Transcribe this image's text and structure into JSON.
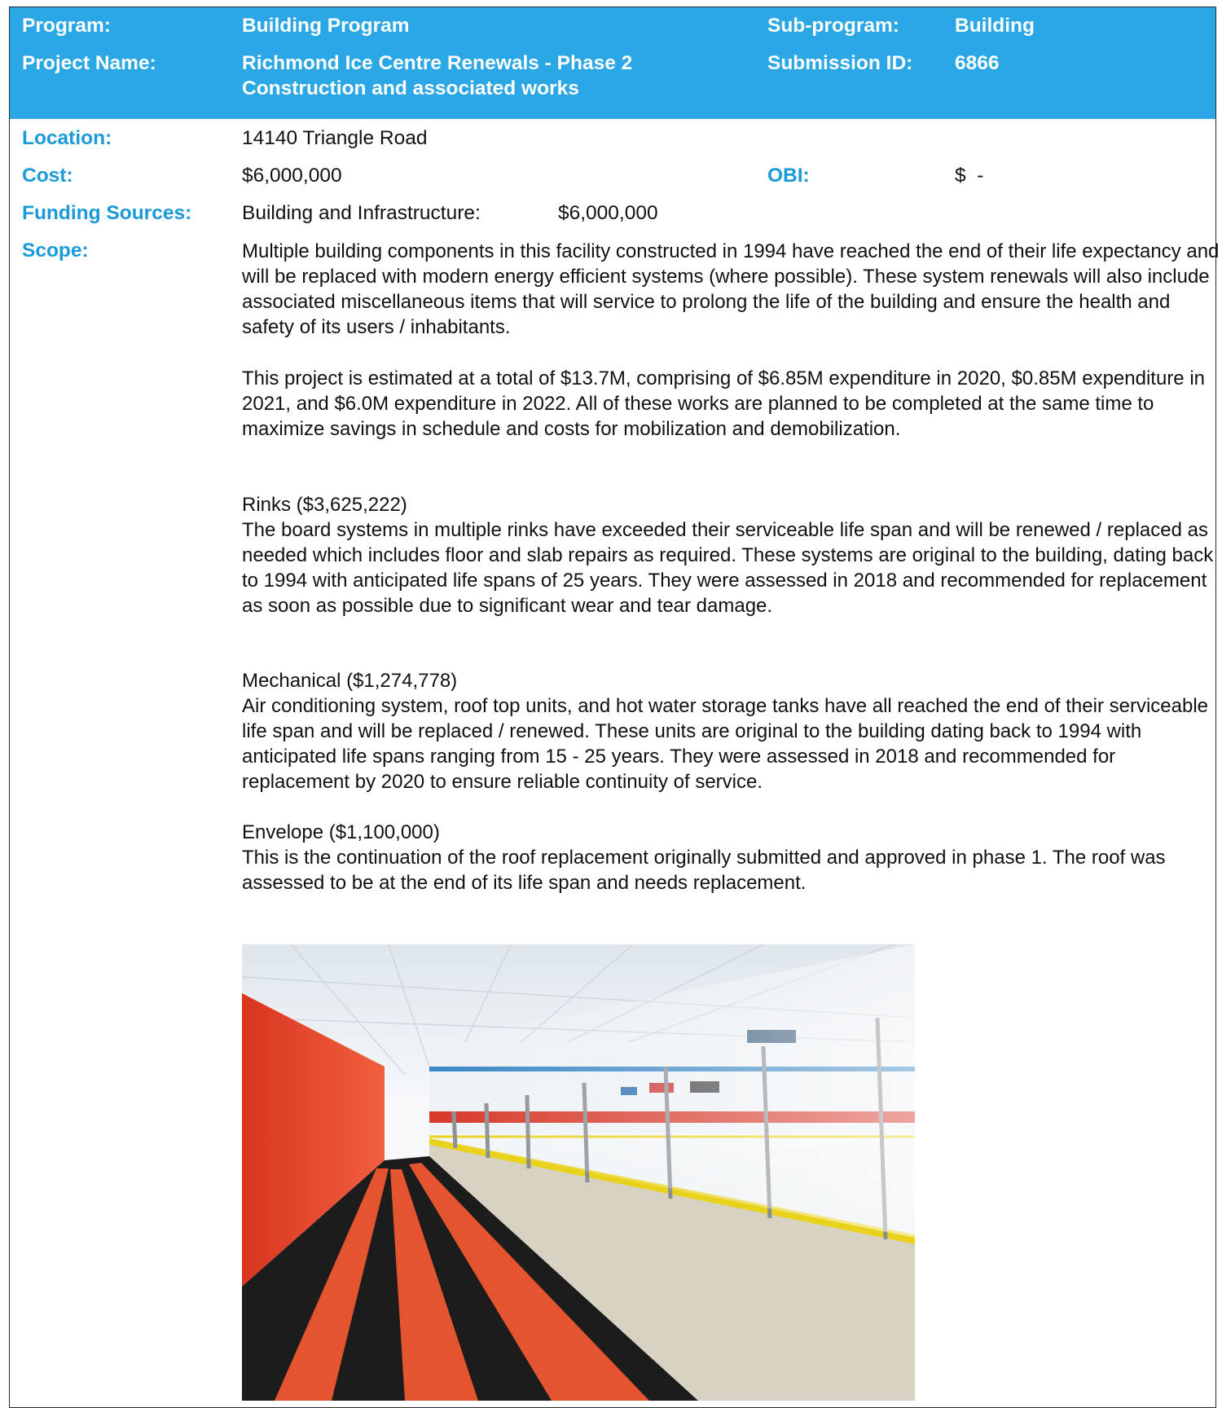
{
  "header": {
    "program_label": "Program:",
    "program_value": "Building Program",
    "subprogram_label": "Sub-program:",
    "subprogram_value": "Building",
    "project_name_label": "Project Name:",
    "project_name_line1": "Richmond Ice Centre Renewals - Phase 2",
    "project_name_line2": "Construction and associated works",
    "submission_id_label": "Submission ID:",
    "submission_id_value": "6866"
  },
  "details": {
    "location_label": "Location:",
    "location_value": "14140 Triangle Road",
    "cost_label": "Cost:",
    "cost_value": "$6,000,000",
    "obi_label": "OBI:",
    "obi_value": "$  -",
    "funding_label": "Funding Sources:",
    "funding_source": "Building and Infrastructure:",
    "funding_amount": "$6,000,000",
    "scope_label": "Scope:"
  },
  "scope": {
    "intro": "Multiple building components in this facility constructed in 1994 have reached the end of their life expectancy and will be replaced with modern energy efficient systems (where possible).  These system renewals will also include associated miscellaneous items that will service to prolong the life of the building and ensure the health and safety of its users / inhabitants.",
    "estimate": "This project is estimated at a total of $13.7M, comprising of $6.85M expenditure in 2020, $0.85M expenditure in 2021, and $6.0M expenditure in 2022.  All of these works are planned to be completed at the same time to maximize savings in schedule and costs for mobilization and demobilization.",
    "rinks_title": "Rinks ($3,625,222)",
    "rinks_text": "The board systems in multiple rinks have exceeded their serviceable life span and will be renewed / replaced as needed which includes floor and slab repairs as required.  These systems are original to the building, dating back to 1994 with anticipated life spans of 25 years.  They were assessed in 2018 and recommended for replacement as soon as possible due to significant wear and tear damage.",
    "mechanical_title": "Mechanical ($1,274,778)",
    "mechanical_text": "Air conditioning system, roof top units, and hot water storage tanks have all reached the end of their serviceable life span and will be replaced / renewed.  These units are original to the building dating back to 1994 with anticipated life spans ranging from 15 - 25 years.  They were assessed in 2018 and recommended for replacement by 2020 to ensure reliable continuity of service.",
    "envelope_title": "Envelope ($1,100,000)",
    "envelope_text": "This is the continuation of the roof replacement originally submitted and approved in phase 1.  The roof was assessed to be at the end of its life span and needs replacement."
  },
  "colors": {
    "header_band": "#2aa7e4",
    "label_blue": "#1b9ad9",
    "boards_red": "#e2452c",
    "dasher_yellow": "#e9d21c"
  }
}
